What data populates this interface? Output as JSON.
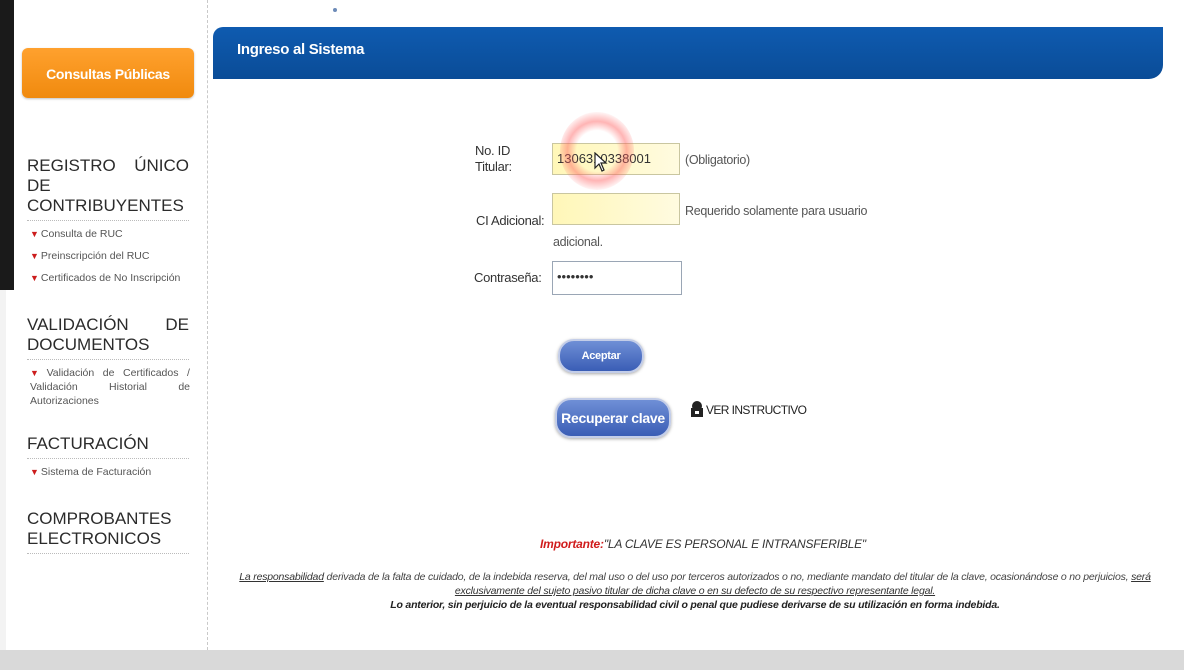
{
  "sidebar": {
    "consultas": "Consultas Públicas",
    "sections": [
      {
        "title": "REGISTRO ÚNICO DE CONTRIBUYENTES",
        "items": [
          "Consulta de RUC",
          "Preinscripción del RUC",
          "Certificados de No Inscripción"
        ]
      },
      {
        "title": "VALIDACIÓN DE DOCUMENTOS",
        "items": [
          "Validación de Certificados / Validación Historial de Autorizaciones"
        ]
      },
      {
        "title": "FACTURACIÓN",
        "items": [
          "Sistema de Facturación"
        ]
      },
      {
        "title": "COMPROBANTES ELECTRONICOS",
        "items": []
      }
    ]
  },
  "header": {
    "title": "Ingreso al Sistema"
  },
  "form": {
    "id_label": "No. ID Titular:",
    "id_value": "1306310338001",
    "id_hint": "(Obligatorio)",
    "ci_label": "CI Adicional:",
    "ci_value": "",
    "ci_hint": "Requerido solamente para usuario",
    "ci_hint2": "adicional.",
    "pwd_label": "Contraseña:",
    "pwd_value": "••••••••",
    "accept_button": "Aceptar",
    "recover_button": "Recuperar clave",
    "instructivo": "VER INSTRUCTIVO"
  },
  "notice": {
    "important_label": "Importante:",
    "important_text": "\"LA CLAVE ES PERSONAL E INTRANSFERIBLE\"",
    "legal_link": "La responsabilidad",
    "legal_text1": " derivada de la falta de cuidado, de la indebida reserva, del mal uso o del uso por terceros autorizados o no, mediante mandato del titular de la clave, ocasionándose o no perjuicios, ",
    "legal_link2": "será exclusivamente del sujeto pasivo titular de dicha clave o en su defecto de su respectivo representante legal.",
    "legal_bold": "Lo anterior, sin perjuicio de la eventual responsabilidad civil o penal que pudiese derivarse de su utilización en forma indebida."
  }
}
